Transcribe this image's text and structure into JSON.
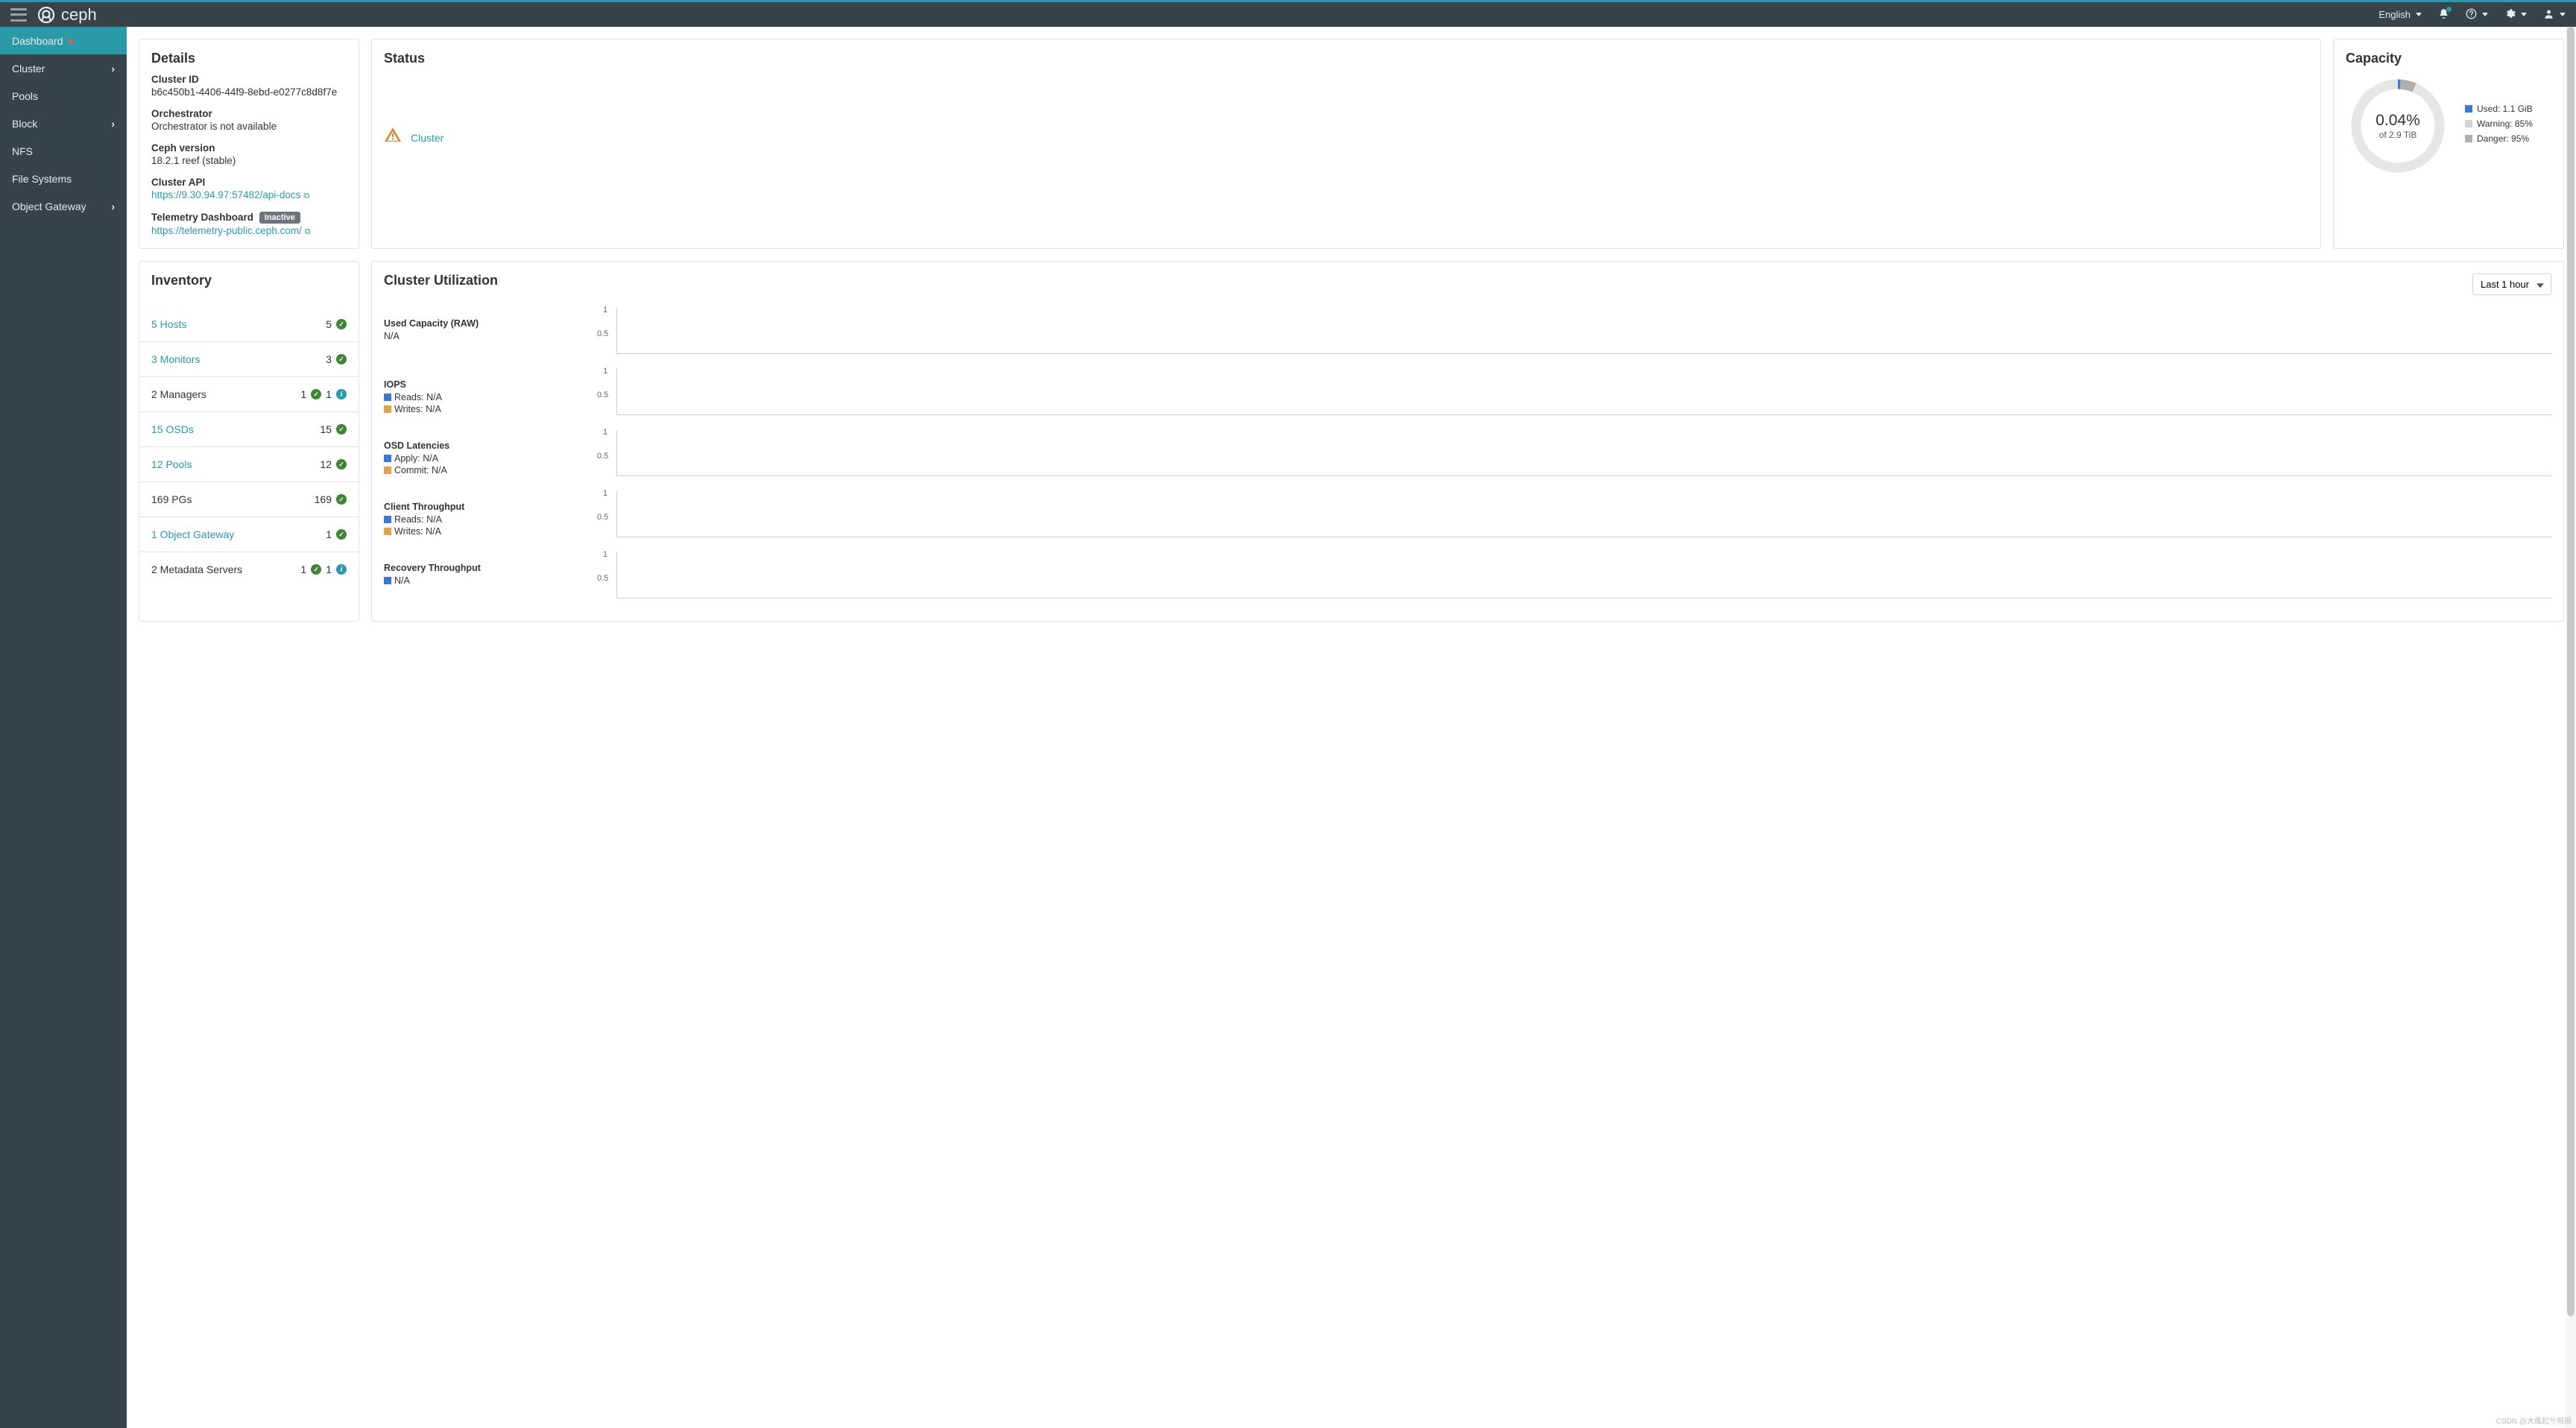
{
  "topbar": {
    "brand": "ceph",
    "language": "English"
  },
  "sidebar": {
    "items": [
      {
        "label": "Dashboard",
        "active": true,
        "badge": "heart"
      },
      {
        "label": "Cluster",
        "chevron": true
      },
      {
        "label": "Pools"
      },
      {
        "label": "Block",
        "chevron": true
      },
      {
        "label": "NFS"
      },
      {
        "label": "File Systems"
      },
      {
        "label": "Object Gateway",
        "chevron": true
      }
    ]
  },
  "details": {
    "heading": "Details",
    "cluster_id_label": "Cluster ID",
    "cluster_id": "b6c450b1-4406-44f9-8ebd-e0277c8d8f7e",
    "orchestrator_label": "Orchestrator",
    "orchestrator": "Orchestrator is not available",
    "version_label": "Ceph version",
    "version": "18.2.1 reef (stable)",
    "api_label": "Cluster API",
    "api_url": "https://9.30.94.97:57482/api-docs",
    "telemetry_label": "Telemetry Dashboard",
    "telemetry_badge": "Inactive",
    "telemetry_url": "https://telemetry-public.ceph.com/"
  },
  "status": {
    "heading": "Status",
    "cluster_label": "Cluster"
  },
  "capacity": {
    "heading": "Capacity",
    "percent": "0.04%",
    "of_total": "of 2.9 TiB",
    "legend": [
      {
        "color": "#3c77d6",
        "label": "Used: 1.1 GiB"
      },
      {
        "color": "#d2d2d2",
        "label": "Warning: 85%"
      },
      {
        "color": "#afafaf",
        "label": "Danger: 95%"
      }
    ]
  },
  "inventory": {
    "heading": "Inventory",
    "rows": [
      {
        "label": "5 Hosts",
        "link": true,
        "right": [
          {
            "n": "5",
            "icon": "ok"
          }
        ]
      },
      {
        "label": "3 Monitors",
        "link": true,
        "right": [
          {
            "n": "3",
            "icon": "ok"
          }
        ]
      },
      {
        "label": "2 Managers",
        "link": false,
        "right": [
          {
            "n": "1",
            "icon": "ok"
          },
          {
            "n": "1",
            "icon": "info"
          }
        ]
      },
      {
        "label": "15 OSDs",
        "link": true,
        "right": [
          {
            "n": "15",
            "icon": "ok"
          }
        ]
      },
      {
        "label": "12 Pools",
        "link": true,
        "right": [
          {
            "n": "12",
            "icon": "ok"
          }
        ]
      },
      {
        "label": "169 PGs",
        "link": false,
        "right": [
          {
            "n": "169",
            "icon": "ok"
          }
        ]
      },
      {
        "label": "1 Object Gateway",
        "link": true,
        "right": [
          {
            "n": "1",
            "icon": "ok"
          }
        ]
      },
      {
        "label": "2 Metadata Servers",
        "link": false,
        "right": [
          {
            "n": "1",
            "icon": "ok"
          },
          {
            "n": "1",
            "icon": "info"
          }
        ]
      }
    ]
  },
  "utilization": {
    "heading": "Cluster Utilization",
    "time_range": "Last 1 hour",
    "ticks": {
      "top": "1",
      "mid": "0.5"
    },
    "rows": [
      {
        "title": "Used Capacity (RAW)",
        "subs": [
          {
            "label": "N/A"
          }
        ]
      },
      {
        "title": "IOPS",
        "subs": [
          {
            "color": "#3c77d6",
            "label": "Reads: N/A"
          },
          {
            "color": "#e0a24b",
            "label": "Writes: N/A"
          }
        ]
      },
      {
        "title": "OSD Latencies",
        "subs": [
          {
            "color": "#3c77d6",
            "label": "Apply: N/A"
          },
          {
            "color": "#e0a24b",
            "label": "Commit: N/A"
          }
        ]
      },
      {
        "title": "Client Throughput",
        "subs": [
          {
            "color": "#3c77d6",
            "label": "Reads: N/A"
          },
          {
            "color": "#e0a24b",
            "label": "Writes: N/A"
          }
        ]
      },
      {
        "title": "Recovery Throughput",
        "subs": [
          {
            "color": "#3c77d6",
            "label": "N/A"
          }
        ]
      }
    ]
  },
  "watermark": "CSDN @大風起兮飛揚"
}
